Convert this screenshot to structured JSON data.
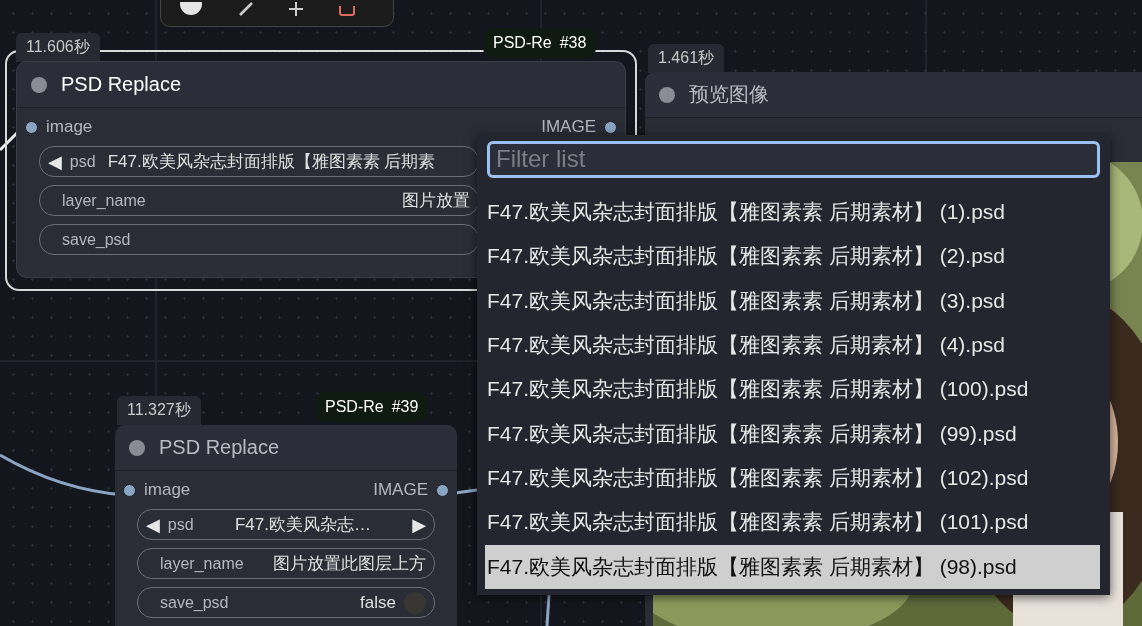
{
  "nodes": [
    {
      "time": "11.606秒",
      "badge_name": "PSD-Re",
      "badge_id": "#38",
      "title": "PSD Replace",
      "selected": true,
      "input": "image",
      "output": "IMAGE",
      "widgets": [
        {
          "kind": "combo",
          "label": "psd",
          "prev": "◀",
          "value": "F47.欧美风杂志封面排版【雅图素素 后期素"
        },
        {
          "kind": "text",
          "label": "layer_name",
          "value": "图片放置"
        },
        {
          "kind": "toggle",
          "label": "save_psd"
        }
      ]
    },
    {
      "time": "11.327秒",
      "badge_name": "PSD-Re",
      "badge_id": "#39",
      "title": "PSD Replace",
      "selected": false,
      "input": "image",
      "output": "IMAGE",
      "widgets": [
        {
          "kind": "combo",
          "label": "psd",
          "prev": "◀",
          "value": "F47.欧美风杂志…",
          "next": "▶"
        },
        {
          "kind": "text",
          "label": "layer_name",
          "value": "图片放置此图层上方"
        },
        {
          "kind": "toggle",
          "label": "save_psd",
          "value": "false",
          "on": false
        }
      ]
    }
  ],
  "preview": {
    "time": "1.461秒",
    "title": "预览图像"
  },
  "dropdown": {
    "placeholder": "Filter list",
    "items": [
      {
        "label": "F47.欧美风杂志封面排版【雅图素素 后期素材】 (1).psd",
        "selected": false
      },
      {
        "label": "F47.欧美风杂志封面排版【雅图素素 后期素材】 (2).psd",
        "selected": false
      },
      {
        "label": "F47.欧美风杂志封面排版【雅图素素 后期素材】 (3).psd",
        "selected": false
      },
      {
        "label": "F47.欧美风杂志封面排版【雅图素素 后期素材】 (4).psd",
        "selected": false
      },
      {
        "label": "F47.欧美风杂志封面排版【雅图素素 后期素材】 (100).psd",
        "selected": false
      },
      {
        "label": "F47.欧美风杂志封面排版【雅图素素 后期素材】 (99).psd",
        "selected": false
      },
      {
        "label": "F47.欧美风杂志封面排版【雅图素素 后期素材】 (102).psd",
        "selected": false
      },
      {
        "label": "F47.欧美风杂志封面排版【雅图素素 后期素材】 (101).psd",
        "selected": false
      },
      {
        "label": "F47.欧美风杂志封面排版【雅图素素 后期素材】 (98).psd",
        "selected": true
      }
    ]
  }
}
